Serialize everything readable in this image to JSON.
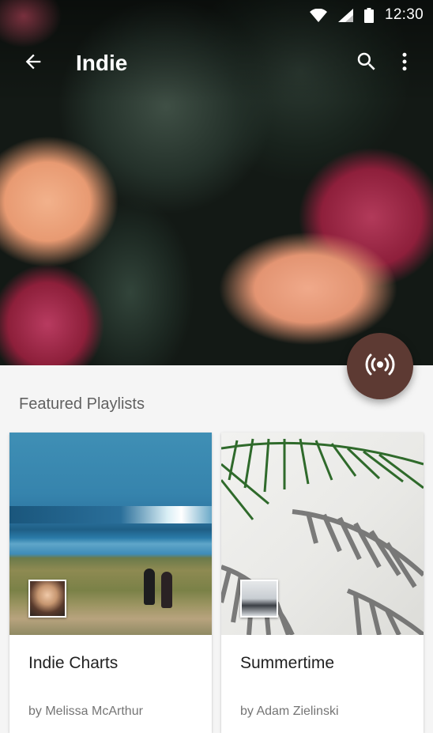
{
  "status_bar": {
    "time": "12:30",
    "icons": [
      "wifi-icon",
      "cellular-signal-icon",
      "battery-icon"
    ]
  },
  "app_bar": {
    "title": "Indie",
    "back_icon": "arrow-back-icon",
    "actions": [
      "search-icon",
      "more-vert-icon"
    ]
  },
  "fab": {
    "icon": "broadcast-radio-icon",
    "color": "#5d3a33"
  },
  "featured": {
    "section_title": "Featured Playlists",
    "playlists": [
      {
        "title": "Indie Charts",
        "subtitle": "by Melissa McArthur"
      },
      {
        "title": "Summertime",
        "subtitle": "by Adam Zielinski"
      }
    ]
  }
}
